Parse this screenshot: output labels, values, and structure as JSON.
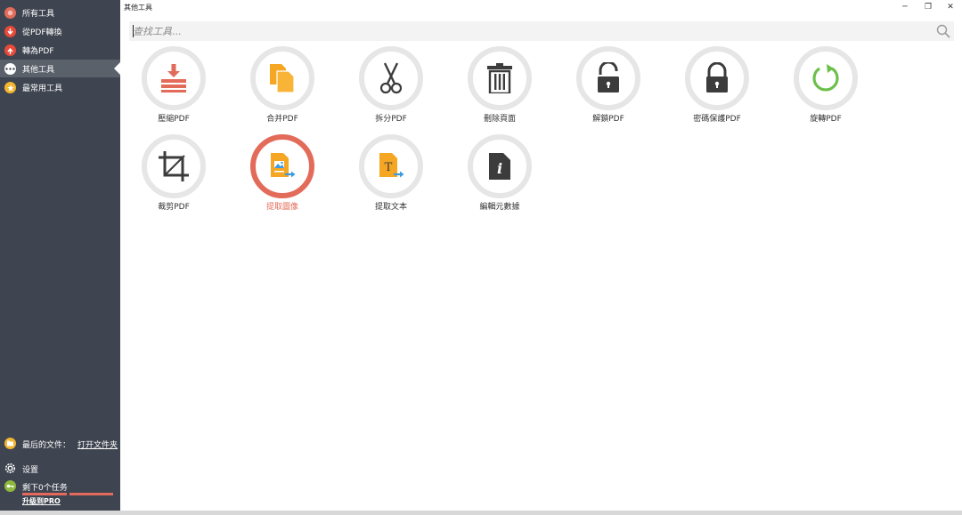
{
  "window": {
    "title": "其他工具",
    "controls": {
      "minimize": "─",
      "restore": "❐",
      "close": "✕"
    }
  },
  "sidebar": {
    "items": [
      {
        "label": "所有工具",
        "icon": "all-tools-icon",
        "color": "#e36b5a"
      },
      {
        "label": "從PDF轉換",
        "icon": "convert-from-pdf-icon",
        "color": "#e84a3a"
      },
      {
        "label": "轉為PDF",
        "icon": "convert-to-pdf-icon",
        "color": "#e84a3a"
      },
      {
        "label": "其他工具",
        "icon": "more-tools-icon",
        "color": "#ffffff",
        "active": true
      },
      {
        "label": "最常用工具",
        "icon": "star-icon",
        "color": "#f2b630"
      }
    ],
    "recent": {
      "label": "最后的文件：",
      "open_folder": "打开文件夹"
    },
    "settings": {
      "label": "设置"
    },
    "tasks": {
      "label": "剩下0个任务",
      "upgrade": "升级到PRO"
    }
  },
  "search": {
    "placeholder": "查找工具..."
  },
  "tools": [
    {
      "label": "壓縮PDF",
      "icon": "compress-icon"
    },
    {
      "label": "合并PDF",
      "icon": "merge-icon"
    },
    {
      "label": "拆分PDF",
      "icon": "scissors-icon"
    },
    {
      "label": "刪除頁面",
      "icon": "trash-icon"
    },
    {
      "label": "解鎖PDF",
      "icon": "unlock-icon"
    },
    {
      "label": "密碼保護PDF",
      "icon": "lock-icon"
    },
    {
      "label": "旋轉PDF",
      "icon": "rotate-icon"
    },
    {
      "label": "裁剪PDF",
      "icon": "crop-icon"
    },
    {
      "label": "提取圖像",
      "icon": "extract-image-icon",
      "selected": true
    },
    {
      "label": "提取文本",
      "icon": "extract-text-icon"
    },
    {
      "label": "編輯元數據",
      "icon": "metadata-icon"
    }
  ],
  "colors": {
    "sidebar_bg": "#3f4550",
    "accent": "#e36b5a",
    "orange": "#f5a623",
    "green": "#6cc04a",
    "dark_icon": "#3c3c3c"
  }
}
